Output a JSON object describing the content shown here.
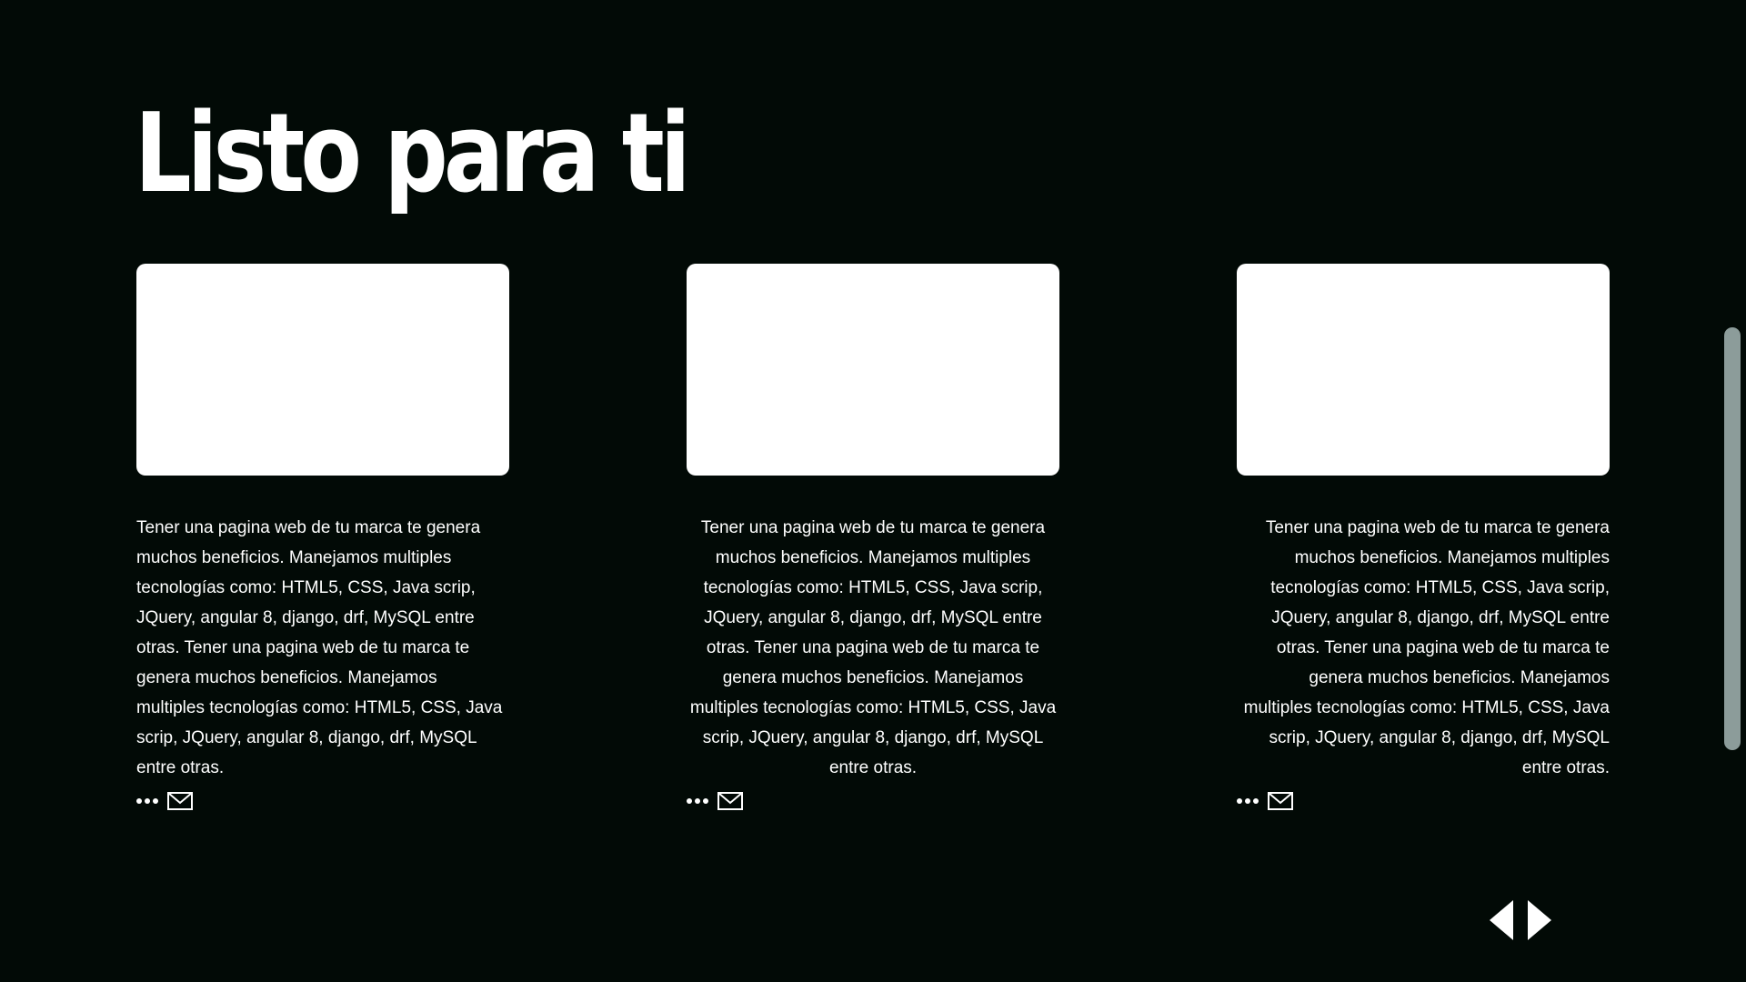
{
  "page": {
    "title": "Listo para ti"
  },
  "cards": [
    {
      "text": "Tener una pagina web de tu marca te genera muchos beneficios. Manejamos multiples tecnologías como: HTML5, CSS, Java scrip, JQuery, angular 8, django, drf, MySQL entre otras. Tener una pagina web de tu marca te genera muchos beneficios. Manejamos multiples tecnologías como: HTML5, CSS, Java scrip,  JQuery, angular 8, django, drf, MySQL entre otras.",
      "more_icon": "more-dots-icon",
      "mail_icon": "mail-icon"
    },
    {
      "text": "Tener una pagina web de tu marca te genera muchos beneficios. Manejamos multiples tecnologías como: HTML5, CSS, Java scrip, JQuery, angular 8, django, drf, MySQL entre otras. Tener una pagina web de tu marca te genera muchos beneficios. Manejamos multiples tecnologías como: HTML5, CSS, Java scrip,  JQuery, angular 8, django, drf, MySQL entre otras.",
      "more_icon": "more-dots-icon",
      "mail_icon": "mail-icon"
    },
    {
      "text": "Tener una pagina web de tu marca te genera muchos beneficios. Manejamos multiples tecnologías como: HTML5, CSS, Java scrip, JQuery, angular 8, django, drf, MySQL entre otras. Tener una pagina web de tu marca te genera muchos beneficios. Manejamos multiples tecnologías como: HTML5, CSS, Java scrip,  JQuery, angular 8, django, drf, MySQL entre otras.",
      "more_icon": "more-dots-icon",
      "mail_icon": "mail-icon"
    }
  ],
  "pager": {
    "prev_icon": "arrow-left-icon",
    "next_icon": "arrow-right-icon"
  },
  "colors": {
    "background": "#020a06",
    "text": "#ffffff",
    "card": "#ffffff",
    "scrollbar": "#8c9c9a"
  }
}
